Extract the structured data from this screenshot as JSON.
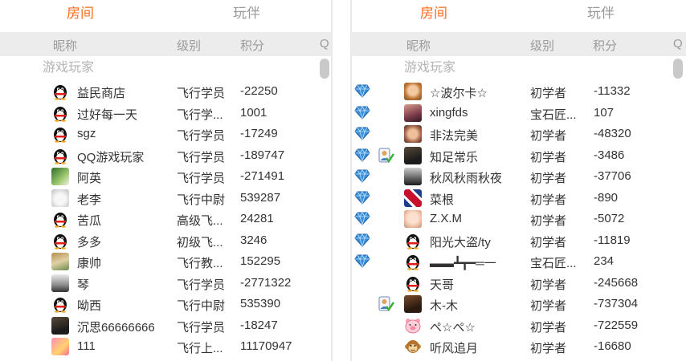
{
  "left": {
    "tabs": [
      {
        "label": "房间",
        "active": true
      },
      {
        "label": "玩伴",
        "active": false
      }
    ],
    "columns": {
      "nickname": "昵称",
      "level": "级别",
      "score": "积分",
      "extra": "Q"
    },
    "group": "游戏玩家",
    "rows": [
      {
        "avatar": "qq-penguin-icon",
        "name": "益民商店",
        "level": "飞行学员",
        "score": "-22250"
      },
      {
        "avatar": "qq-penguin-icon",
        "name": "过好每一天",
        "level": "飞行学...",
        "score": "1001"
      },
      {
        "avatar": "qq-penguin-icon",
        "name": "sgz",
        "level": "飞行学员",
        "score": "-17249"
      },
      {
        "avatar": "qq-penguin-icon",
        "name": "QQ游戏玩家",
        "level": "飞行学员",
        "score": "-189747"
      },
      {
        "avatar": "green-photo-icon",
        "name": "阿英",
        "level": "飞行学员",
        "score": "-271491"
      },
      {
        "avatar": "cat-photo-icon",
        "name": "老李",
        "level": "飞行中尉",
        "score": "539287"
      },
      {
        "avatar": "qq-penguin-icon",
        "name": "苦瓜",
        "level": "高级飞...",
        "score": "24281"
      },
      {
        "avatar": "qq-penguin-icon",
        "name": "多多",
        "level": "初级飞...",
        "score": "3246"
      },
      {
        "avatar": "landscape-photo-icon",
        "name": "康帅",
        "level": "飞行教...",
        "score": "152295"
      },
      {
        "avatar": "animal-photo-icon",
        "name": "琴",
        "level": "飞行学员",
        "score": "-2771322"
      },
      {
        "avatar": "qq-penguin-icon",
        "name": "呦西",
        "level": "飞行中尉",
        "score": "535390"
      },
      {
        "avatar": "dark-photo-icon",
        "name": "沉思66666666",
        "level": "飞行学员",
        "score": "-18247"
      },
      {
        "avatar": "pink-photo-icon",
        "name": "111",
        "level": "飞行上...",
        "score": "11170947"
      }
    ]
  },
  "right": {
    "tabs": [
      {
        "label": "房间",
        "active": true
      },
      {
        "label": "玩伴",
        "active": false
      }
    ],
    "columns": {
      "nickname": "昵称",
      "level": "级别",
      "score": "积分",
      "extra": "Q"
    },
    "group": "游戏玩家",
    "rows": [
      {
        "gem": "gem-icon",
        "vip": "",
        "avatar": "girl-photo-icon",
        "name": "☆波尔卡☆",
        "level": "初学者",
        "score": "-11332"
      },
      {
        "gem": "gem-icon",
        "vip": "",
        "avatar": "woman-photo-icon",
        "name": "xingfds",
        "level": "宝石匠...",
        "score": "107"
      },
      {
        "gem": "gem-icon",
        "vip": "",
        "avatar": "face-photo-icon",
        "name": "非法完美",
        "level": "初学者",
        "score": "-48320"
      },
      {
        "gem": "gem-icon",
        "vip": "vip-user-icon",
        "avatar": "dark-photo-icon",
        "name": "知足常乐",
        "level": "初学者",
        "score": "-3486"
      },
      {
        "gem": "gem-icon",
        "vip": "",
        "avatar": "silhouette-photo-icon",
        "name": "秋风秋雨秋夜",
        "level": "初学者",
        "score": "-37706"
      },
      {
        "gem": "gem-icon",
        "vip": "",
        "avatar": "flag-photo-icon",
        "name": "菜根",
        "level": "初学者",
        "score": "-890"
      },
      {
        "gem": "gem-icon",
        "vip": "",
        "avatar": "baby-photo-icon",
        "name": "Z.X.M",
        "level": "初学者",
        "score": "-5072"
      },
      {
        "gem": "gem-icon",
        "vip": "",
        "avatar": "qq-penguin-icon",
        "name": "阳光大盗/ty",
        "level": "初学者",
        "score": "-11819"
      },
      {
        "gem": "gem-icon",
        "vip": "",
        "avatar": "qq-penguin-icon",
        "name": "▬▬┻┳━═一",
        "level": "宝石匠...",
        "score": "234"
      },
      {
        "gem": "",
        "vip": "",
        "avatar": "qq-penguin-icon",
        "name": "天哥",
        "level": "初学者",
        "score": "-245668"
      },
      {
        "gem": "",
        "vip": "vip-user-icon",
        "avatar": "man-photo-icon",
        "name": "木-木",
        "level": "初学者",
        "score": "-737304"
      },
      {
        "gem": "",
        "vip": "",
        "avatar": "cartoon-pig-icon",
        "name": "ぺ☆ぺ☆",
        "level": "初学者",
        "score": "-722559"
      },
      {
        "gem": "",
        "vip": "",
        "avatar": "cartoon-monkey-icon",
        "name": "听风追月",
        "level": "初学者",
        "score": "-16680"
      }
    ]
  },
  "colors": {
    "active_tab": "#ff6d1f",
    "header_bg": "#ececec",
    "text": "#333333",
    "muted": "#999999",
    "gem": "#3a8fd9"
  }
}
